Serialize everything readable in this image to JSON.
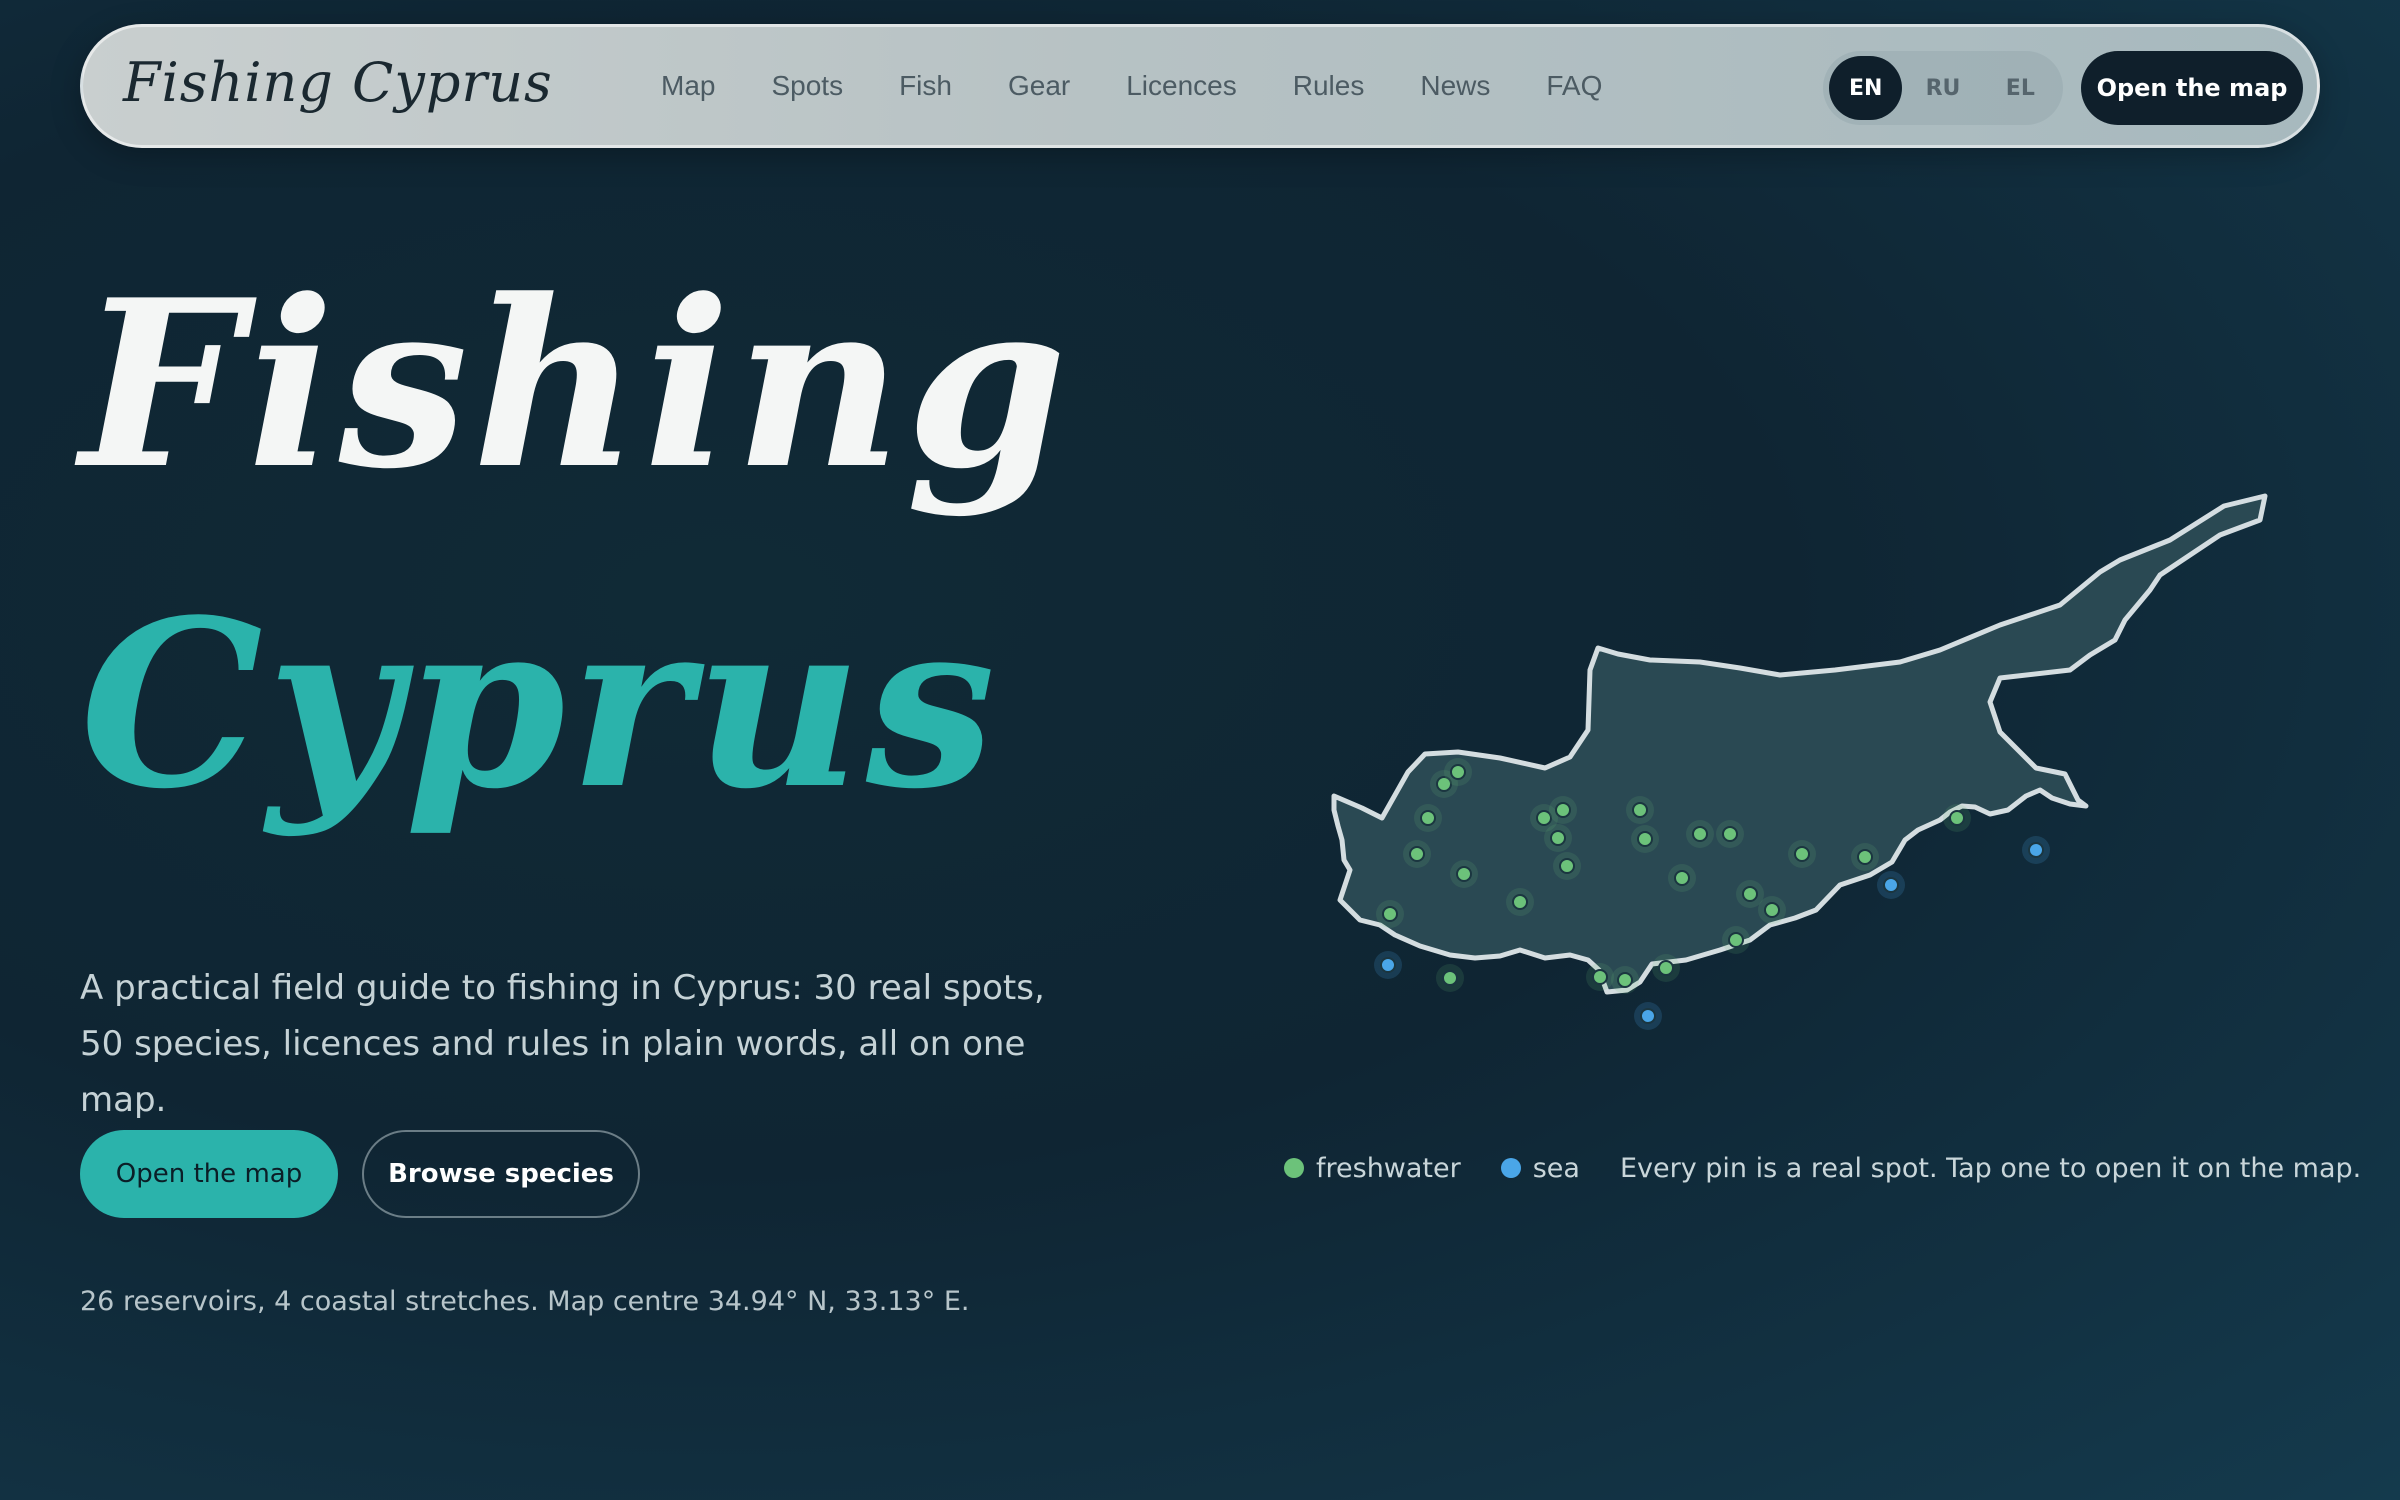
{
  "header": {
    "brand": "Fishing Cyprus",
    "nav": [
      "Map",
      "Spots",
      "Fish",
      "Gear",
      "Licences",
      "Rules",
      "News",
      "FAQ"
    ],
    "languages": [
      {
        "code": "EN",
        "active": true
      },
      {
        "code": "RU",
        "active": false
      },
      {
        "code": "EL",
        "active": false
      }
    ],
    "cta": "Open the map"
  },
  "hero": {
    "title_line1": "Fishing",
    "title_line2": "Cyprus",
    "description": "A practical field guide to fishing in Cyprus: 30 real spots, 50 species, licences and rules in plain words, all on one map.",
    "primary_button": "Open the map",
    "secondary_button": "Browse species",
    "stats": "26 reservoirs, 4 coastal stretches. Map centre 34.94° N, 33.13° E."
  },
  "map": {
    "legend": {
      "freshwater": "freshwater",
      "sea": "sea",
      "note": "Every pin is a real spot. Tap one to open it on the map."
    },
    "colors": {
      "freshwater": "#6cc27a",
      "sea": "#4aa6e8",
      "land": "#2c4b55",
      "outline": "#dfe7ea"
    }
  },
  "colors": {
    "accent": "#2bb3ab",
    "nav_dark": "#0f1f2b"
  }
}
